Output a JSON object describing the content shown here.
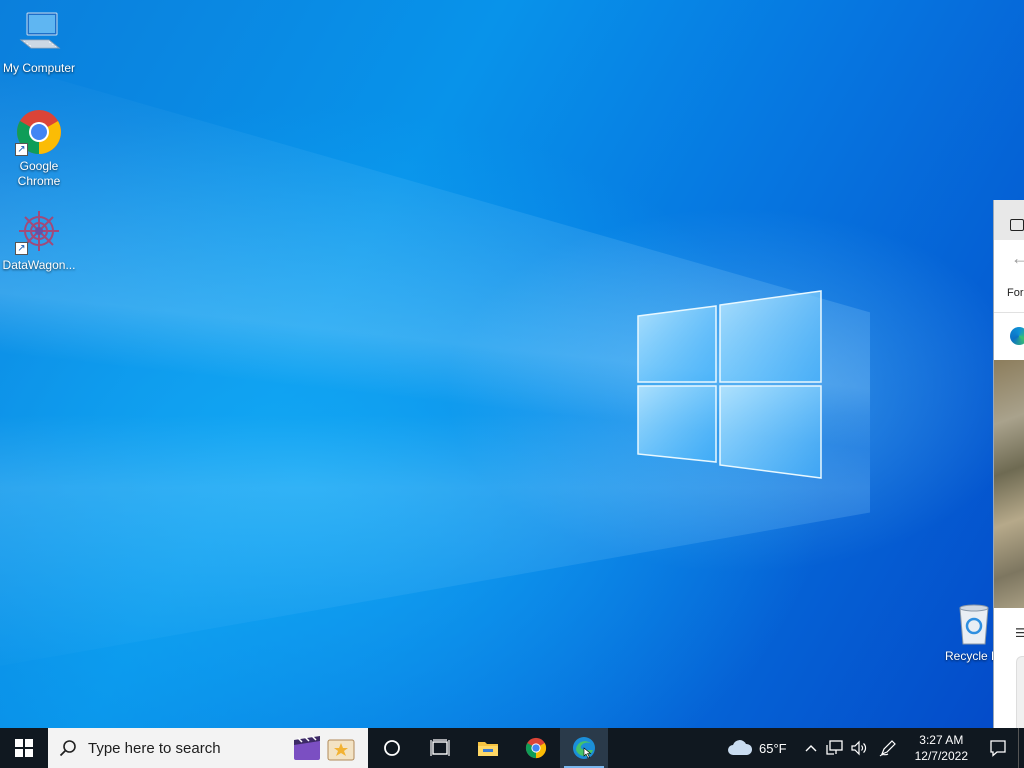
{
  "desktop": {
    "icons": [
      {
        "label": "My Computer",
        "icon": "computer-icon"
      },
      {
        "label": "Google Chrome",
        "icon": "chrome-icon"
      },
      {
        "label": "DataWagon...",
        "icon": "datawagon-icon"
      },
      {
        "label": "Recycle B",
        "icon": "recycle-bin-icon"
      }
    ]
  },
  "side_window": {
    "partial_text": "For"
  },
  "taskbar": {
    "search_placeholder": "Type here to search",
    "apps": [
      "file-explorer-icon",
      "chrome-icon",
      "edge-icon"
    ],
    "weather": {
      "temp": "65°F",
      "icon": "cloud-icon"
    },
    "clock": {
      "time": "3:27 AM",
      "date": "12/7/2022"
    }
  },
  "colors": {
    "taskbar": "#101820",
    "wallpaper_accent": "#0893ea"
  }
}
